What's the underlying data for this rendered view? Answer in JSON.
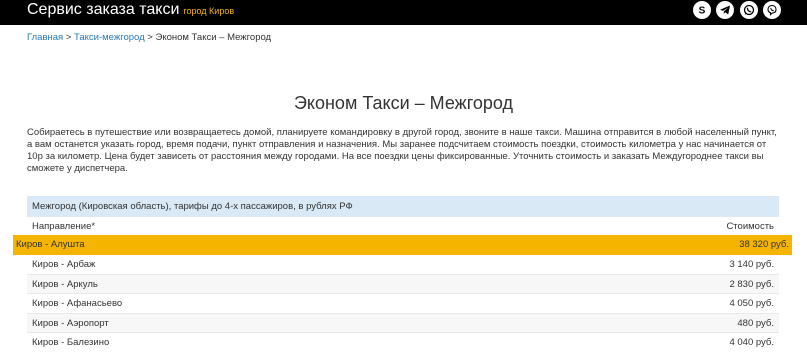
{
  "header": {
    "title": "Сервис заказа такси",
    "city": "город Киров",
    "social": [
      {
        "name": "skype-icon"
      },
      {
        "name": "telegram-icon"
      },
      {
        "name": "whatsapp-icon"
      },
      {
        "name": "viber-icon"
      }
    ]
  },
  "breadcrumb": {
    "home": "Главная",
    "sep1": " > ",
    "section": "Такси-межгород",
    "sep2": " > ",
    "current": "Эконом Такси – Межгород"
  },
  "page": {
    "title": "Эконом Такси – Межгород",
    "intro": "Собираетесь в путешествие или возвращаетесь домой, планируете командировку в другой город, звоните в наше такси. Машина отправится в любой населенный пункт, а вам останется указать город, время подачи, пункт отправления и назначения. Мы заранее подсчитаем стоимость поездки, стоимость километра у нас начинается от 10р за километр. Цена будет зависеть от расстояния между городами. На все поездки цены фиксированные. Уточнить стоимость и заказать Междугороднее такси вы сможете у диспетчера."
  },
  "table": {
    "caption": "Межгород (Кировская область), тарифы до 4-х пассажиров, в рублях РФ",
    "col_direction": "Направление*",
    "col_price": "Стоимость",
    "rows": [
      {
        "route": "Киров - Алушта",
        "price": "38 320 руб."
      },
      {
        "route": "Киров - Арбаж",
        "price": "3 140 руб."
      },
      {
        "route": "Киров - Аркуль",
        "price": "2 830 руб."
      },
      {
        "route": "Киров - Афанасьево",
        "price": "4 050 руб."
      },
      {
        "route": "Киров - Аэропорт",
        "price": "480 руб."
      },
      {
        "route": "Киров - Балезино",
        "price": "4 040 руб."
      }
    ]
  },
  "colors": {
    "topbar": "#000000",
    "accent": "#f5b400",
    "link": "#2a7ab8",
    "caption_bg": "#d9e9f5"
  }
}
